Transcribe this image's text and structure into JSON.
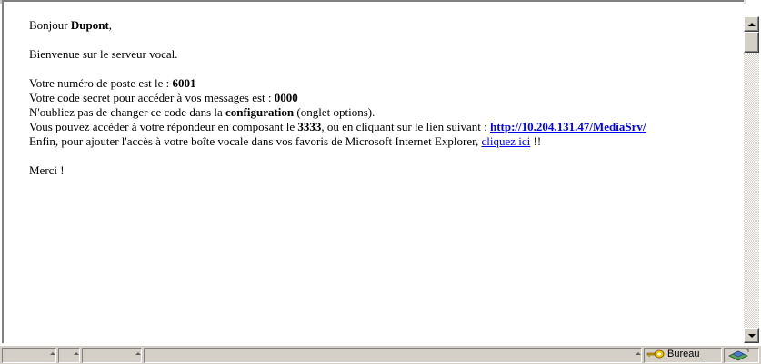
{
  "message": {
    "greeting_prefix": "Bonjour ",
    "user_name": "Dupont",
    "greeting_suffix": ",",
    "welcome": "Bienvenue sur le serveur vocal.",
    "extension_prefix": "Votre numéro de poste est le : ",
    "extension_number": "6001",
    "code_prefix": "Votre code secret pour accéder à vos messages est : ",
    "code_value": "0000",
    "change_prefix": "N'oubliez pas de changer ce code dans la ",
    "change_bold": "configuration",
    "change_suffix": " (onglet options).",
    "access_prefix": "Vous pouvez accéder à votre répondeur en composant le ",
    "access_number": "3333",
    "access_middle": ", ou en cliquant sur le lien suivant : ",
    "access_link": "http://10.204.131.47/MediaSrv/",
    "favorites_prefix": "Enfin, pour ajouter l'accès à votre boîte vocale dans vos favoris de Microsoft Internet Explorer, ",
    "favorites_link": "cliquez ici",
    "favorites_suffix": " !!",
    "thanks": "Merci !"
  },
  "status_bar": {
    "zone_label": "Bureau",
    "lock_icon": "key-lock-icon",
    "zone_icon": "network-zone-icon"
  },
  "colors": {
    "link": "#0000ee",
    "chrome": "#d4d0c8"
  }
}
